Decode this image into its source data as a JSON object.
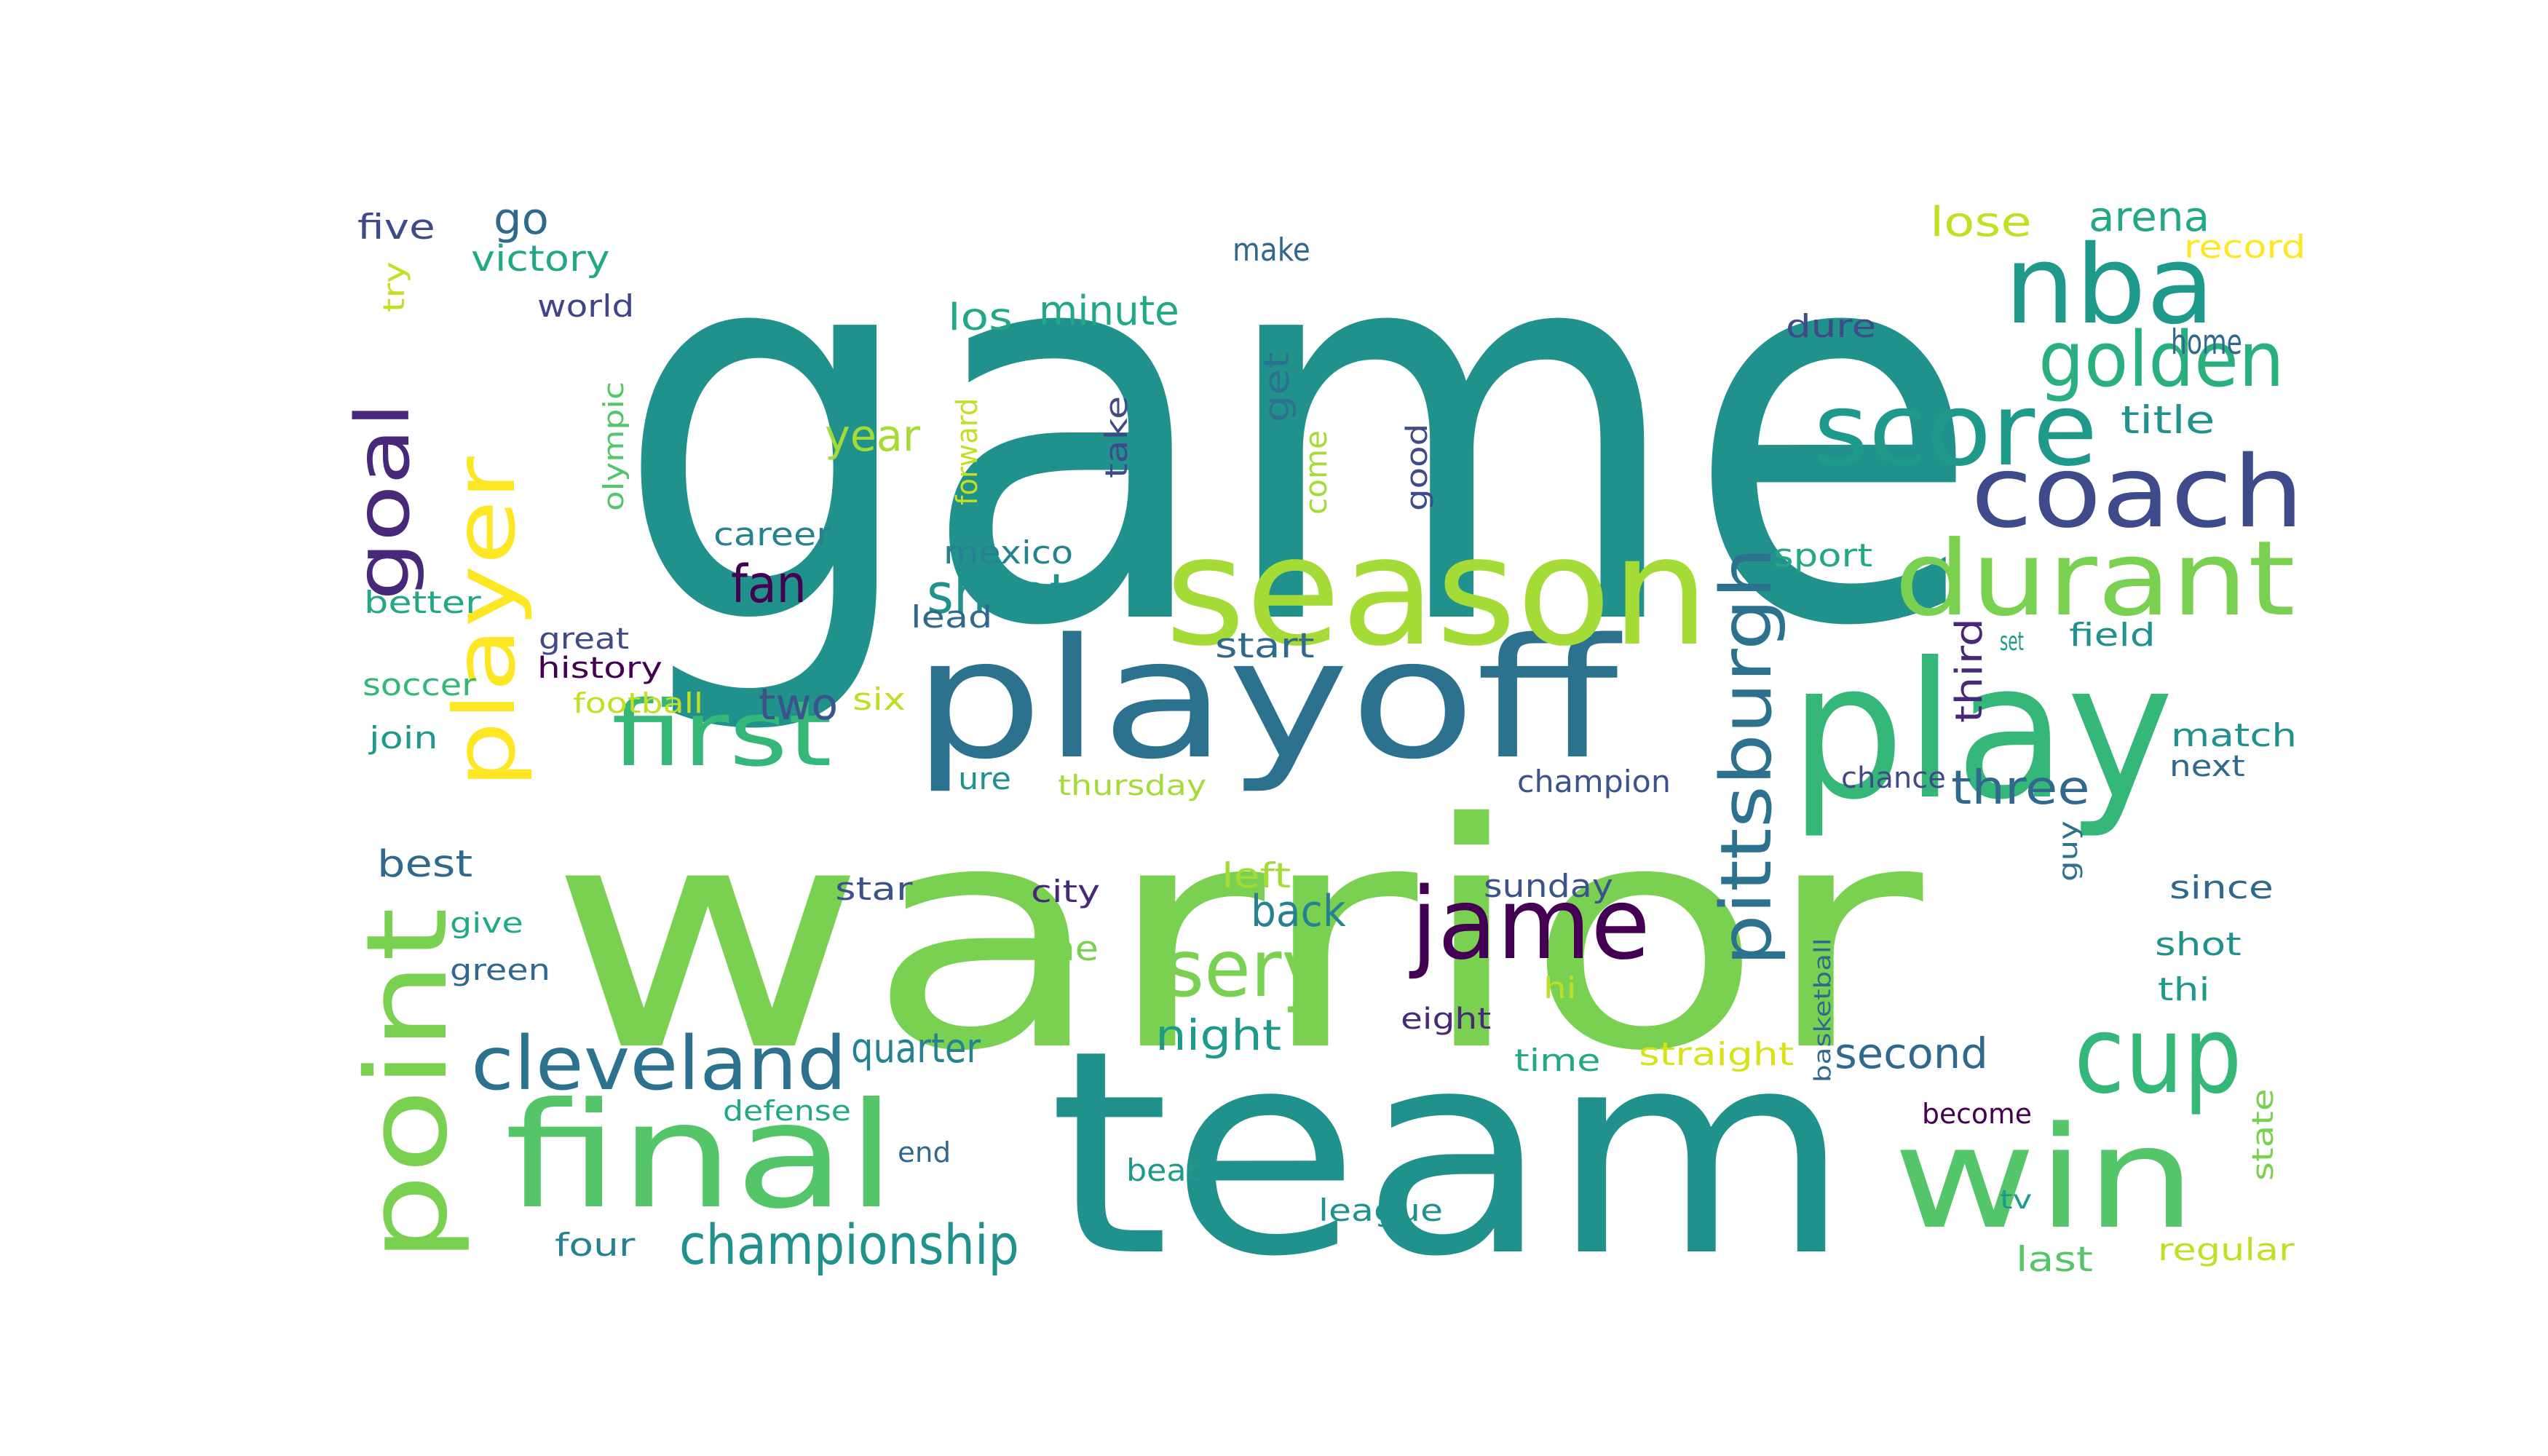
{
  "words": [
    {
      "text": "game",
      "color": "#21918c"
    },
    {
      "text": "warrior",
      "color": "#7ad151"
    },
    {
      "text": "team",
      "color": "#21918c"
    },
    {
      "text": "playoff",
      "color": "#2c728e"
    },
    {
      "text": "play",
      "color": "#35b779"
    },
    {
      "text": "season",
      "color": "#a5db36"
    },
    {
      "text": "player",
      "color": "#fde725"
    },
    {
      "text": "point",
      "color": "#7ad151"
    },
    {
      "text": "final",
      "color": "#54c568"
    },
    {
      "text": "win",
      "color": "#54c568"
    },
    {
      "text": "durant",
      "color": "#7ad151"
    },
    {
      "text": "coach",
      "color": "#3e4a89"
    },
    {
      "text": "nba",
      "color": "#1f9a8a"
    },
    {
      "text": "jame",
      "color": "#440154"
    },
    {
      "text": "cup",
      "color": "#35b779"
    },
    {
      "text": "goal",
      "color": "#482878"
    },
    {
      "text": "first",
      "color": "#35b779"
    },
    {
      "text": "score",
      "color": "#1f9a8a"
    },
    {
      "text": "cleveland",
      "color": "#2c728e"
    },
    {
      "text": "golden",
      "color": "#2ab07f"
    },
    {
      "text": "pittsburgh",
      "color": "#2c728e"
    },
    {
      "text": "sery",
      "color": "#7ad151"
    },
    {
      "text": "championship",
      "color": "#21918c"
    },
    {
      "text": "shoot",
      "color": "#21918c"
    },
    {
      "text": "fan",
      "color": "#440154"
    },
    {
      "text": "three",
      "color": "#31688e"
    },
    {
      "text": "two",
      "color": "#3b528b"
    },
    {
      "text": "best",
      "color": "#31688e"
    },
    {
      "text": "year",
      "color": "#a5db36"
    },
    {
      "text": "quarter",
      "color": "#26828e"
    },
    {
      "text": "second",
      "color": "#31688e"
    },
    {
      "text": "night",
      "color": "#1f9a8a"
    },
    {
      "text": "back",
      "color": "#26828e"
    },
    {
      "text": "minute",
      "color": "#22a884"
    },
    {
      "text": "los",
      "color": "#22a884"
    },
    {
      "text": "arena",
      "color": "#22a884"
    },
    {
      "text": "title",
      "color": "#21918c"
    },
    {
      "text": "lose",
      "color": "#c2df23"
    },
    {
      "text": "go",
      "color": "#31688e"
    },
    {
      "text": "victory",
      "color": "#22a884"
    },
    {
      "text": "five",
      "color": "#3e4a89"
    },
    {
      "text": "world",
      "color": "#414487"
    },
    {
      "text": "try",
      "color": "#c2df23"
    },
    {
      "text": "make",
      "color": "#31688e"
    },
    {
      "text": "record",
      "color": "#fde725"
    },
    {
      "text": "dure",
      "color": "#3e4a89"
    },
    {
      "text": "home",
      "color": "#31688e"
    },
    {
      "text": "get",
      "color": "#2c728e"
    },
    {
      "text": "take",
      "color": "#3e4a89"
    },
    {
      "text": "good",
      "color": "#3e4a89"
    },
    {
      "text": "come",
      "color": "#a5db36"
    },
    {
      "text": "forward",
      "color": "#c2df23"
    },
    {
      "text": "olympic",
      "color": "#54c568"
    },
    {
      "text": "career",
      "color": "#26828e"
    },
    {
      "text": "mexico",
      "color": "#26828e"
    },
    {
      "text": "lead",
      "color": "#31688e"
    },
    {
      "text": "start",
      "color": "#31688e"
    },
    {
      "text": "sport",
      "color": "#22a884"
    },
    {
      "text": "set",
      "color": "#1f9a8a"
    },
    {
      "text": "field",
      "color": "#21918c"
    },
    {
      "text": "third",
      "color": "#482878"
    },
    {
      "text": "better",
      "color": "#22a884"
    },
    {
      "text": "great",
      "color": "#3e4a89"
    },
    {
      "text": "history",
      "color": "#440154"
    },
    {
      "text": "soccer",
      "color": "#35b779"
    },
    {
      "text": "football",
      "color": "#c2df23"
    },
    {
      "text": "six",
      "color": "#bddf26"
    },
    {
      "text": "join",
      "color": "#1f9a8a"
    },
    {
      "text": "ure",
      "color": "#21918c"
    },
    {
      "text": "thursday",
      "color": "#a5db36"
    },
    {
      "text": "champion",
      "color": "#3b528b"
    },
    {
      "text": "chance",
      "color": "#3e4a89"
    },
    {
      "text": "match",
      "color": "#21918c"
    },
    {
      "text": "next",
      "color": "#31688e"
    },
    {
      "text": "guy",
      "color": "#2c728e"
    },
    {
      "text": "left",
      "color": "#a5db36"
    },
    {
      "text": "star",
      "color": "#3b528b"
    },
    {
      "text": "city",
      "color": "#482878"
    },
    {
      "text": "sunday",
      "color": "#3b528b"
    },
    {
      "text": "since",
      "color": "#31688e"
    },
    {
      "text": "give",
      "color": "#22a884"
    },
    {
      "text": "one",
      "color": "#7ad151"
    },
    {
      "text": "shot",
      "color": "#21918c"
    },
    {
      "text": "green",
      "color": "#31688e"
    },
    {
      "text": "hi",
      "color": "#bddf26"
    },
    {
      "text": "thi",
      "color": "#1f9a8a"
    },
    {
      "text": "basketball",
      "color": "#31688e"
    },
    {
      "text": "eight",
      "color": "#482878"
    },
    {
      "text": "time",
      "color": "#22a884"
    },
    {
      "text": "straight",
      "color": "#d8e219"
    },
    {
      "text": "defense",
      "color": "#22a884"
    },
    {
      "text": "end",
      "color": "#31688e"
    },
    {
      "text": "become",
      "color": "#440154"
    },
    {
      "text": "state",
      "color": "#7ad151"
    },
    {
      "text": "beat",
      "color": "#1f9a8a"
    },
    {
      "text": "league",
      "color": "#21918c"
    },
    {
      "text": "tv",
      "color": "#1f9a8a"
    },
    {
      "text": "four",
      "color": "#26828e"
    },
    {
      "text": "last",
      "color": "#54c568"
    },
    {
      "text": "regular",
      "color": "#c2df23"
    }
  ]
}
